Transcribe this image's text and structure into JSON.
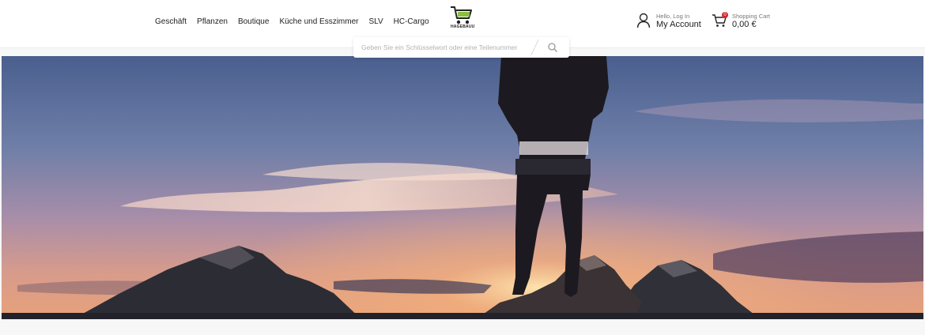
{
  "nav": {
    "items": [
      {
        "label": "Geschäft"
      },
      {
        "label": "Pflanzen"
      },
      {
        "label": "Boutique"
      },
      {
        "label": "Küche und Esszimmer"
      },
      {
        "label": "SLV"
      },
      {
        "label": "HC-Cargo"
      }
    ]
  },
  "logo": {
    "text": "HAGEBAUU",
    "icon": "shopping-cart-logo"
  },
  "account": {
    "greeting": "Hello, Log In",
    "label": "My Account",
    "icon": "user-icon"
  },
  "cart": {
    "label": "Shopping Cart",
    "total": "0,00 €",
    "count": "0",
    "icon": "cart-icon",
    "badge_color": "#d9232e"
  },
  "search": {
    "placeholder": "Geben Sie ein Schlüsselwort oder eine Teilenummer",
    "value": "",
    "icon": "search-icon"
  },
  "hero": {
    "description_icon": "hiker-on-mountain-sunset"
  },
  "colors": {
    "accent_green": "#8bbf3f",
    "text": "#222222",
    "muted": "#777777"
  }
}
